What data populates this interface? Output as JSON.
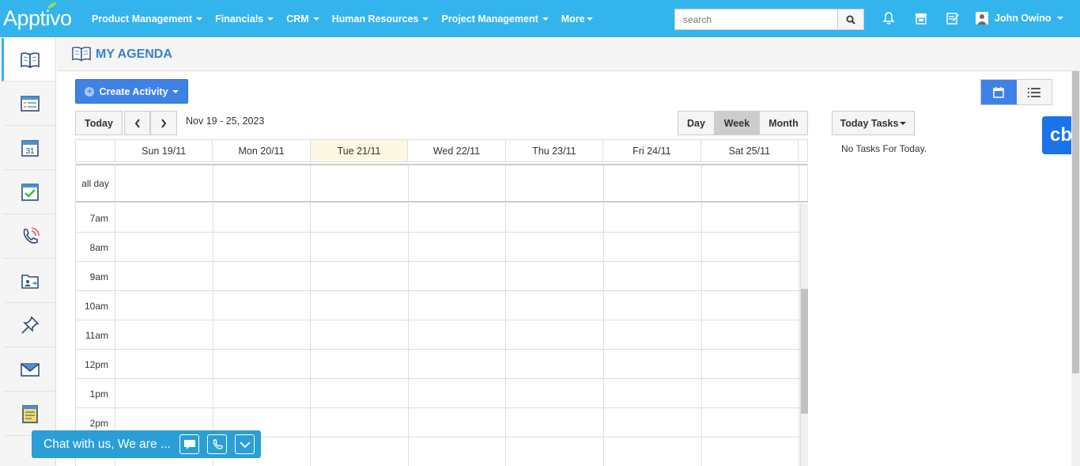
{
  "app": {
    "logo": "Apptivo"
  },
  "nav": {
    "menu": [
      {
        "label": "Product Management"
      },
      {
        "label": "Financials"
      },
      {
        "label": "CRM"
      },
      {
        "label": "Human Resources"
      },
      {
        "label": "Project Management"
      },
      {
        "label": "More"
      }
    ],
    "search_placeholder": "search",
    "user_name": "John Owino"
  },
  "page": {
    "title": "MY AGENDA"
  },
  "toolbar": {
    "create_label": "Create Activity",
    "today_label": "Today",
    "date_range": "Nov 19 - 25, 2023",
    "view_day": "Day",
    "view_week": "Week",
    "view_month": "Month",
    "active_view": "Week"
  },
  "calendar": {
    "days": [
      "Sun 19/11",
      "Mon 20/11",
      "Tue 21/11",
      "Wed 22/11",
      "Thu 23/11",
      "Fri 24/11",
      "Sat 25/11"
    ],
    "today_index": 2,
    "allday_label": "all day",
    "hours": [
      "7am",
      "8am",
      "9am",
      "10am",
      "11am",
      "12pm",
      "1pm",
      "2pm",
      ""
    ]
  },
  "tasks": {
    "button_label": "Today Tasks",
    "empty_text": "No Tasks For Today."
  },
  "badge": {
    "text": "cb"
  },
  "chat": {
    "label": "Chat with us, We are ..."
  },
  "colors": {
    "nav": "#33b4ec",
    "primary": "#3f82e6",
    "today": "#fcf8e3",
    "title": "#3b7fd0"
  }
}
